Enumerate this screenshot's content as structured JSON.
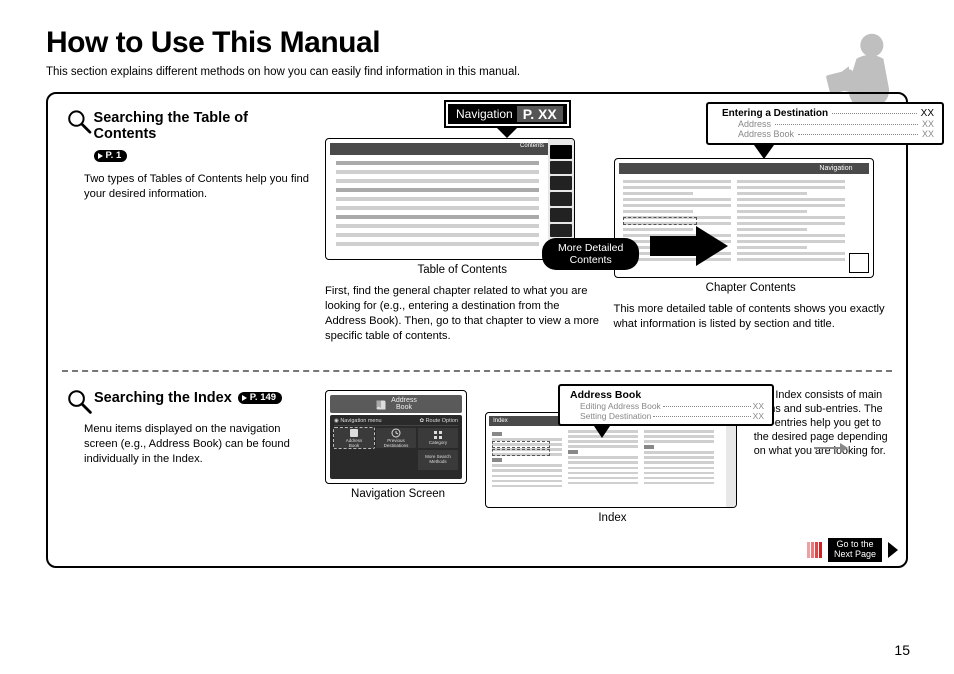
{
  "heading": "How to Use This Manual",
  "intro": "This section explains different methods on how you can easily find information in this manual.",
  "page_number": "15",
  "section1": {
    "title": "Searching the Table of Contents",
    "pill": "P. 1",
    "body": "Two types of Tables of Contents help you find your desired information.",
    "nav_callout_label": "Navigation",
    "nav_callout_page": "P. XX",
    "ribbon": "More Detailed\nContents",
    "toc_caption": "Table of Contents",
    "toc_tab_label": "Contents",
    "toc_desc": "First, find the general chapter related to what you are looking for (e.g., entering a destination from the Address Book). Then, go to that chapter to view a more specific table of contents.",
    "dest_callout": {
      "line1": "Entering a Destination",
      "line2": "Address",
      "line3": "Address Book",
      "xx": "XX"
    },
    "chapter_nav_label": "Navigation",
    "chapter_caption": "Chapter Contents",
    "chapter_desc": "This more detailed table of contents shows you exactly what information is listed by section and title."
  },
  "section2": {
    "title": "Searching the Index",
    "pill": "P. 149",
    "body": "Menu items displayed on the navigation screen (e.g., Address Book) can be found individually in the Index.",
    "nav_screen": {
      "top_label": "Address\nBook",
      "strip_left": "Navigation menu",
      "strip_right": "Route Option",
      "cells": [
        "Address\nBook",
        "Previous\nDestinations",
        "Category",
        "More Search\nMethods"
      ],
      "caption": "Navigation Screen"
    },
    "ab_callout": {
      "title": "Address Book",
      "line1": "Editing Address Book",
      "line2": "Setting Destination",
      "xx": "XX"
    },
    "index_caption": "Index",
    "index_bar_label": "Index",
    "right_text": "The Index consists of main terms and sub-entries. The sub-entries help you get to the desired page depending on what you are looking for."
  },
  "next_page": "Go to the\nNext Page"
}
